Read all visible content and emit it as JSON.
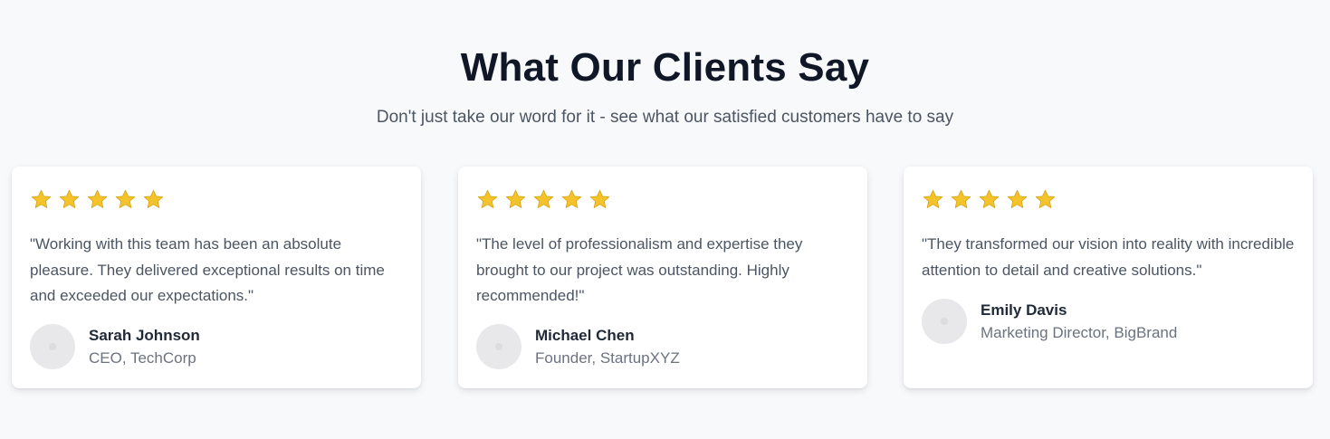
{
  "header": {
    "title": "What Our Clients Say",
    "subtitle": "Don't just take our word for it - see what our satisfied customers have to say"
  },
  "colors": {
    "star": "#f4c22b",
    "title": "#101828",
    "text": "#4b5563",
    "background": "#f8f9fb"
  },
  "testimonials": [
    {
      "rating": 5,
      "quote": "\"Working with this team has been an absolute pleasure. They delivered exceptional results on time and exceeded our expectations.\"",
      "name": "Sarah Johnson",
      "role": "CEO, TechCorp"
    },
    {
      "rating": 5,
      "quote": "\"The level of professionalism and expertise they brought to our project was outstanding. Highly recommended!\"",
      "name": "Michael Chen",
      "role": "Founder, StartupXYZ"
    },
    {
      "rating": 5,
      "quote": "\"They transformed our vision into reality with incredible attention to detail and creative solutions.\"",
      "name": "Emily Davis",
      "role": "Marketing Director, BigBrand"
    }
  ]
}
